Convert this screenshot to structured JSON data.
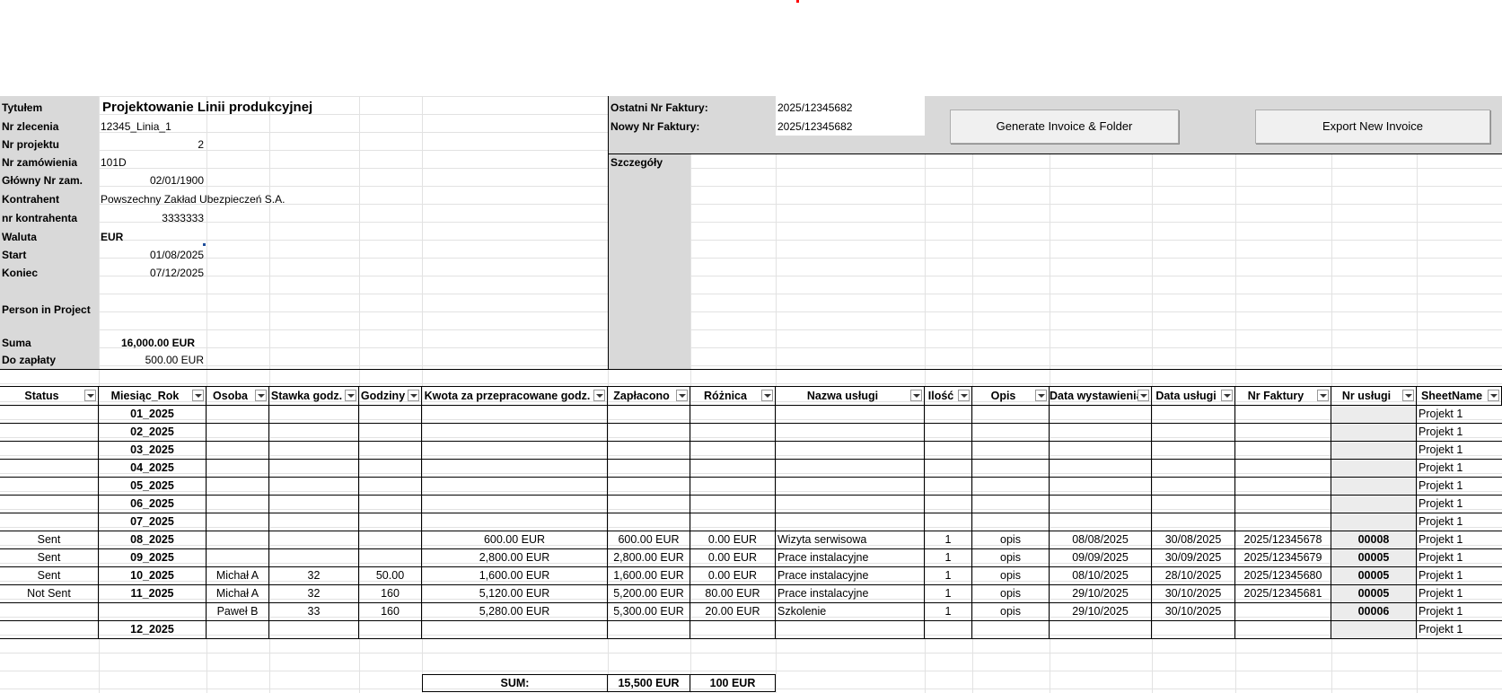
{
  "info": {
    "tytulem_label": "Tytułem",
    "tytulem_value": "Projektowanie Linii produkcyjnej",
    "nr_zlecenia_label": "Nr zlecenia",
    "nr_zlecenia_value": "12345_Linia_1",
    "nr_projektu_label": "Nr projektu",
    "nr_projektu_value": "2",
    "nr_zamowienia_label": "Nr zamówienia",
    "nr_zamowienia_value": "101D",
    "glowny_label": "Główny Nr zam.",
    "glowny_value": "02/01/1900",
    "kontrahent_label": "Kontrahent",
    "kontrahent_value": "Powszechny Zakład Ubezpieczeń S.A.",
    "nr_kontrahenta_label": "nr kontrahenta",
    "nr_kontrahenta_value": "3333333",
    "waluta_label": "Waluta",
    "waluta_value": "EUR",
    "start_label": "Start",
    "start_value": "01/08/2025",
    "koniec_label": "Koniec",
    "koniec_value": "07/12/2025",
    "person_label": "Person in Project",
    "suma_label": "Suma",
    "suma_value": "16,000.00 EUR",
    "do_zaplaty_label": "Do zapłaty",
    "do_zaplaty_value": "500.00 EUR"
  },
  "invoice": {
    "ostatni_label": "Ostatni Nr Faktury:",
    "ostatni_value": "2025/12345682",
    "nowy_label": "Nowy Nr Faktury:",
    "nowy_value": "2025/12345682",
    "szczegoly_label": "Szczegóły",
    "generate_button": "Generate Invoice & Folder",
    "export_button": "Export New Invoice"
  },
  "table": {
    "headers": [
      "Status",
      "Miesiąc_Rok",
      "Osoba",
      "Stawka godz.",
      "Godziny",
      "Kwota za przepracowane godz.",
      "Zapłacono",
      "Różnica",
      "Nazwa usługi",
      "Ilość",
      "Opis",
      "Data wystawienia",
      "Data usługi",
      "Nr Faktury",
      "Nr usługi",
      "SheetName"
    ],
    "rows": [
      [
        "",
        "01_2025",
        "",
        "",
        "",
        "",
        "",
        "",
        "",
        "",
        "",
        "",
        "",
        "",
        "",
        "Projekt 1"
      ],
      [
        "",
        "02_2025",
        "",
        "",
        "",
        "",
        "",
        "",
        "",
        "",
        "",
        "",
        "",
        "",
        "",
        "Projekt 1"
      ],
      [
        "",
        "03_2025",
        "",
        "",
        "",
        "",
        "",
        "",
        "",
        "",
        "",
        "",
        "",
        "",
        "",
        "Projekt 1"
      ],
      [
        "",
        "04_2025",
        "",
        "",
        "",
        "",
        "",
        "",
        "",
        "",
        "",
        "",
        "",
        "",
        "",
        "Projekt 1"
      ],
      [
        "",
        "05_2025",
        "",
        "",
        "",
        "",
        "",
        "",
        "",
        "",
        "",
        "",
        "",
        "",
        "",
        "Projekt 1"
      ],
      [
        "",
        "06_2025",
        "",
        "",
        "",
        "",
        "",
        "",
        "",
        "",
        "",
        "",
        "",
        "",
        "",
        "Projekt 1"
      ],
      [
        "",
        "07_2025",
        "",
        "",
        "",
        "",
        "",
        "",
        "",
        "",
        "",
        "",
        "",
        "",
        "",
        "Projekt 1"
      ],
      [
        "Sent",
        "08_2025",
        "",
        "",
        "",
        "600.00 EUR",
        "600.00 EUR",
        "0.00 EUR",
        "Wizyta serwisowa",
        "1",
        "opis",
        "08/08/2025",
        "30/08/2025",
        "2025/12345678",
        "00008",
        "Projekt 1"
      ],
      [
        "Sent",
        "09_2025",
        "",
        "",
        "",
        "2,800.00 EUR",
        "2,800.00 EUR",
        "0.00 EUR",
        "Prace instalacyjne",
        "1",
        "opis",
        "09/09/2025",
        "30/09/2025",
        "2025/12345679",
        "00005",
        "Projekt 1"
      ],
      [
        "Sent",
        "10_2025",
        "Michał A",
        "32",
        "50.00",
        "1,600.00 EUR",
        "1,600.00 EUR",
        "0.00 EUR",
        "Prace instalacyjne",
        "1",
        "opis",
        "08/10/2025",
        "28/10/2025",
        "2025/12345680",
        "00005",
        "Projekt 1"
      ],
      [
        "Not Sent",
        "11_2025",
        "Michał A",
        "32",
        "160",
        "5,120.00 EUR",
        "5,200.00 EUR",
        "80.00 EUR",
        "Prace instalacyjne",
        "1",
        "opis",
        "29/10/2025",
        "30/10/2025",
        "2025/12345681",
        "00005",
        "Projekt 1"
      ],
      [
        "",
        "",
        "Paweł B",
        "33",
        "160",
        "5,280.00 EUR",
        "5,300.00 EUR",
        "20.00 EUR",
        "Szkolenie",
        "1",
        "opis",
        "29/10/2025",
        "30/10/2025",
        "",
        "00006",
        "Projekt 1"
      ],
      [
        "",
        "12_2025",
        "",
        "",
        "",
        "",
        "",
        "",
        "",
        "",
        "",
        "",
        "",
        "",
        "",
        "Projekt 1"
      ]
    ],
    "sum_label": "SUM:",
    "sum_zaplacono": "15,500 EUR",
    "sum_roznica": "100 EUR"
  },
  "colors": {
    "gray_fill": "#d9d9d9",
    "gridline": "#e2e2e2",
    "selection_marker": "#ff0000"
  }
}
